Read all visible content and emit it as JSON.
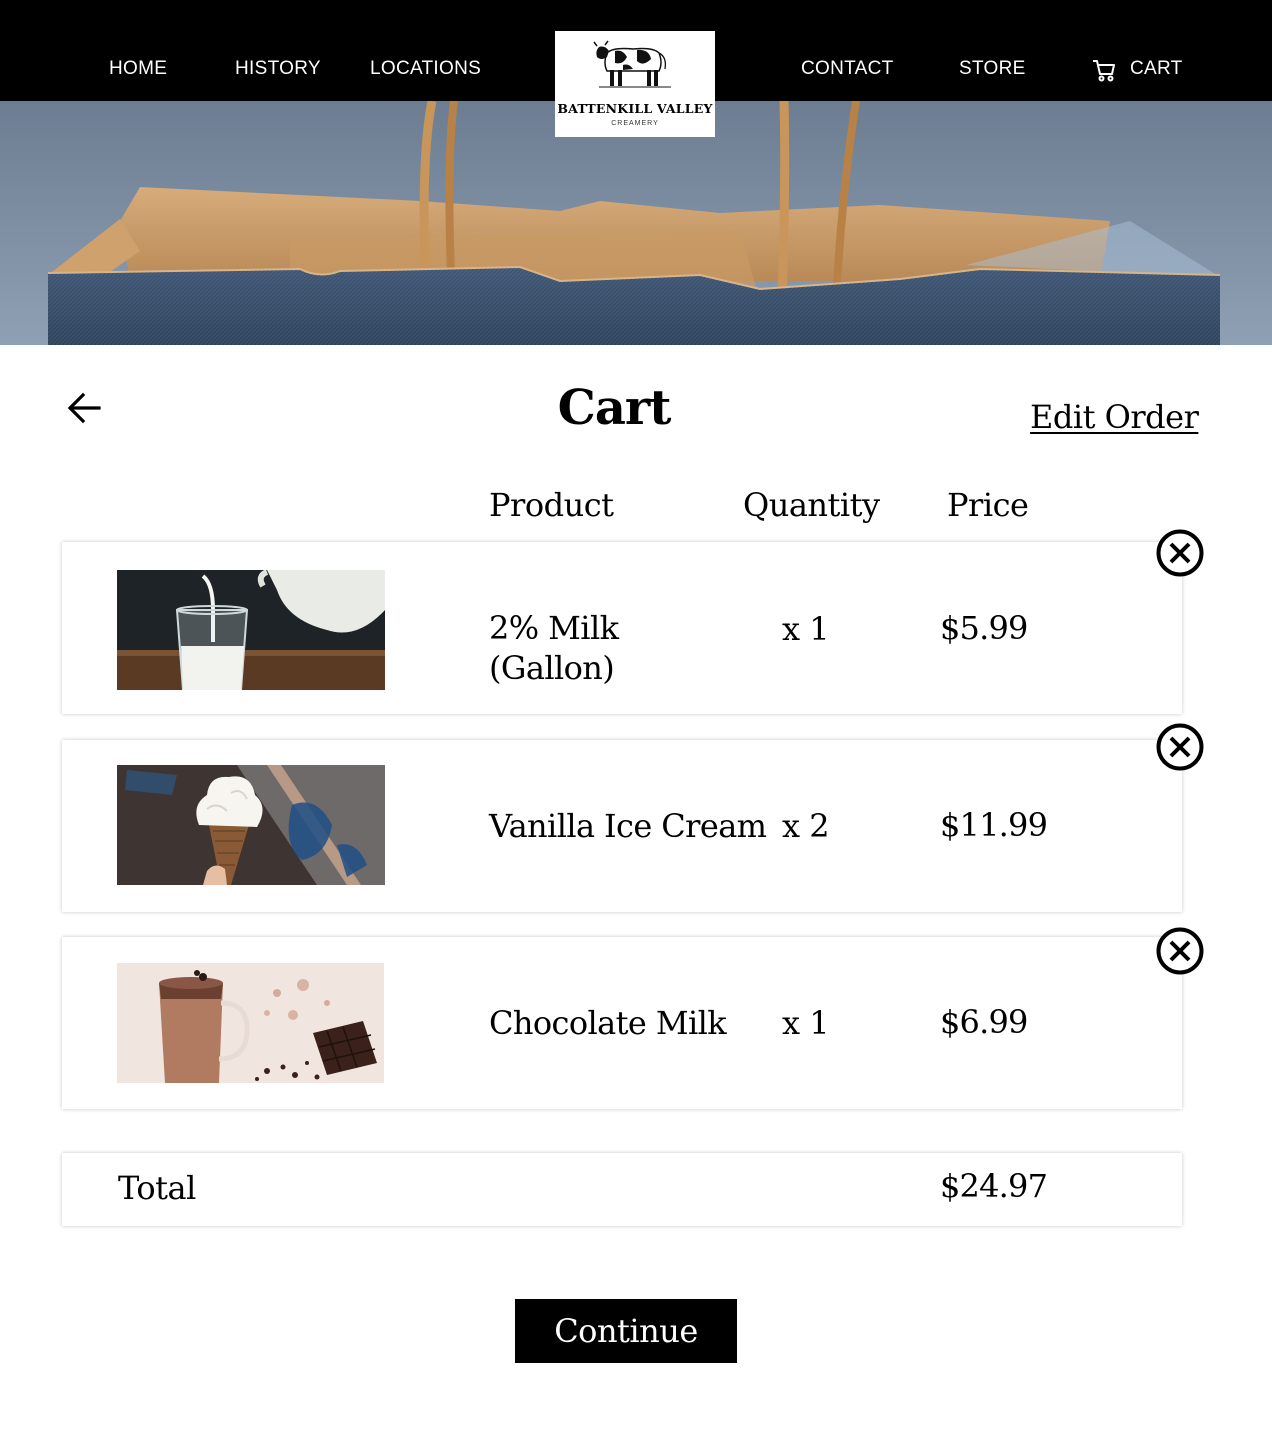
{
  "nav": {
    "home": "HOME",
    "history": "HISTORY",
    "locations": "LOCATIONS",
    "contact": "CONTACT",
    "store": "STORE",
    "cart": "CART",
    "cart_icon": "shopping-cart-icon"
  },
  "logo": {
    "name": "BATTENKILL VALLEY",
    "sub": "CREAMERY",
    "icon": "cow-icon"
  },
  "page": {
    "title": "Cart",
    "edit_order": "Edit Order",
    "back_icon": "arrow-left-icon"
  },
  "columns": {
    "product": "Product",
    "quantity": "Quantity",
    "price": "Price"
  },
  "items": [
    {
      "name_line1": "2% Milk",
      "name_line2": "(Gallon)",
      "quantity": "x 1",
      "price": "$5.99",
      "image": "milk-pour-photo"
    },
    {
      "name_line1": "Vanilla Ice Cream",
      "quantity": "x 2",
      "price": "$11.99",
      "image": "ice-cream-cone-photo"
    },
    {
      "name_line1": "Chocolate Milk",
      "quantity": "x 1",
      "price": "$6.99",
      "image": "chocolate-milk-photo"
    }
  ],
  "remove_icon": "close-circle-icon",
  "total": {
    "label": "Total",
    "value": "$24.97"
  },
  "continue_label": "Continue",
  "colors": {
    "nav_bg": "#000000",
    "text": "#000000",
    "button_bg": "#000000",
    "button_text": "#ffffff"
  }
}
